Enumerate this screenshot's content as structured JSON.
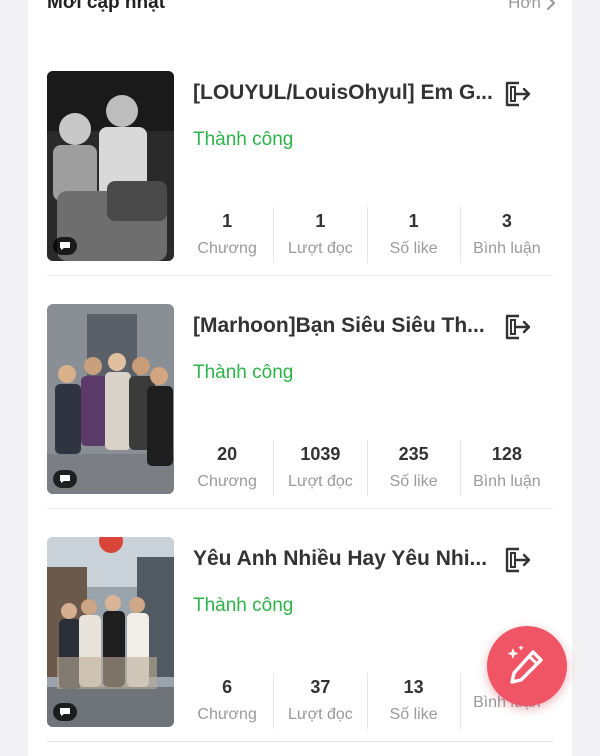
{
  "header": {
    "title": "Mới cập nhật",
    "more_label": "Hơn"
  },
  "stories": [
    {
      "title": "[LOUYUL/LouisOhyul] Em G...",
      "status": "Thành công",
      "stats": [
        {
          "value": "1",
          "label": "Chương"
        },
        {
          "value": "1",
          "label": "Lượt đọc"
        },
        {
          "value": "1",
          "label": "Số like"
        },
        {
          "value": "3",
          "label": "Bình luận"
        }
      ]
    },
    {
      "title": "[Marhoon]Bạn Siêu Siêu Th...",
      "status": "Thành công",
      "stats": [
        {
          "value": "20",
          "label": "Chương"
        },
        {
          "value": "1039",
          "label": "Lượt đọc"
        },
        {
          "value": "235",
          "label": "Số like"
        },
        {
          "value": "128",
          "label": "Bình luận"
        }
      ]
    },
    {
      "title": "Yêu Anh Nhiều Hay Yêu Nhi...",
      "status": "Thành công",
      "stats": [
        {
          "value": "6",
          "label": "Chương"
        },
        {
          "value": "37",
          "label": "Lượt đọc"
        },
        {
          "value": "13",
          "label": "Số like"
        },
        {
          "value": "",
          "label": "Bình luận"
        }
      ]
    }
  ],
  "icons": {
    "more": "chevron-right-icon",
    "exit": "exit-icon",
    "badge": "chat-bubble-icon",
    "fab": "magic-pencil-icon"
  },
  "colors": {
    "status_success": "#2cb34a",
    "fab": "#ef5565",
    "muted": "#9a9a9a"
  }
}
